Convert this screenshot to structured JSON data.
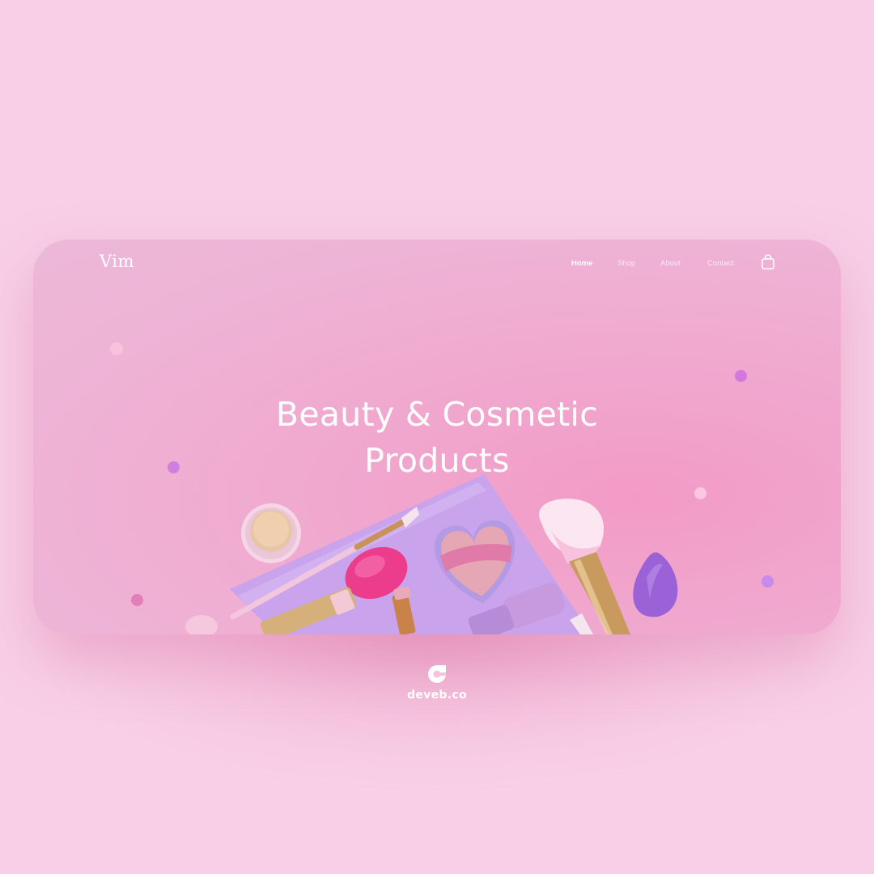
{
  "brand": {
    "logo_text": "Vim"
  },
  "nav": {
    "items": [
      {
        "label": "Home"
      },
      {
        "label": "Shop"
      },
      {
        "label": "About"
      },
      {
        "label": "Contact"
      }
    ],
    "active": "Home",
    "cart_icon": "shopping-bag-icon"
  },
  "hero": {
    "title_line1": "Beauty & Cosmetic",
    "title_line2": "Products"
  },
  "footer": {
    "brand_text": "deveb.co",
    "brand_icon": "deveb-logo-icon"
  },
  "colors": {
    "page_background": "#f8cfe6",
    "card_background": "#f0a9cf",
    "text": "#ffffff",
    "accent_purple": "#c58de8",
    "accent_pink": "#e868b0"
  }
}
